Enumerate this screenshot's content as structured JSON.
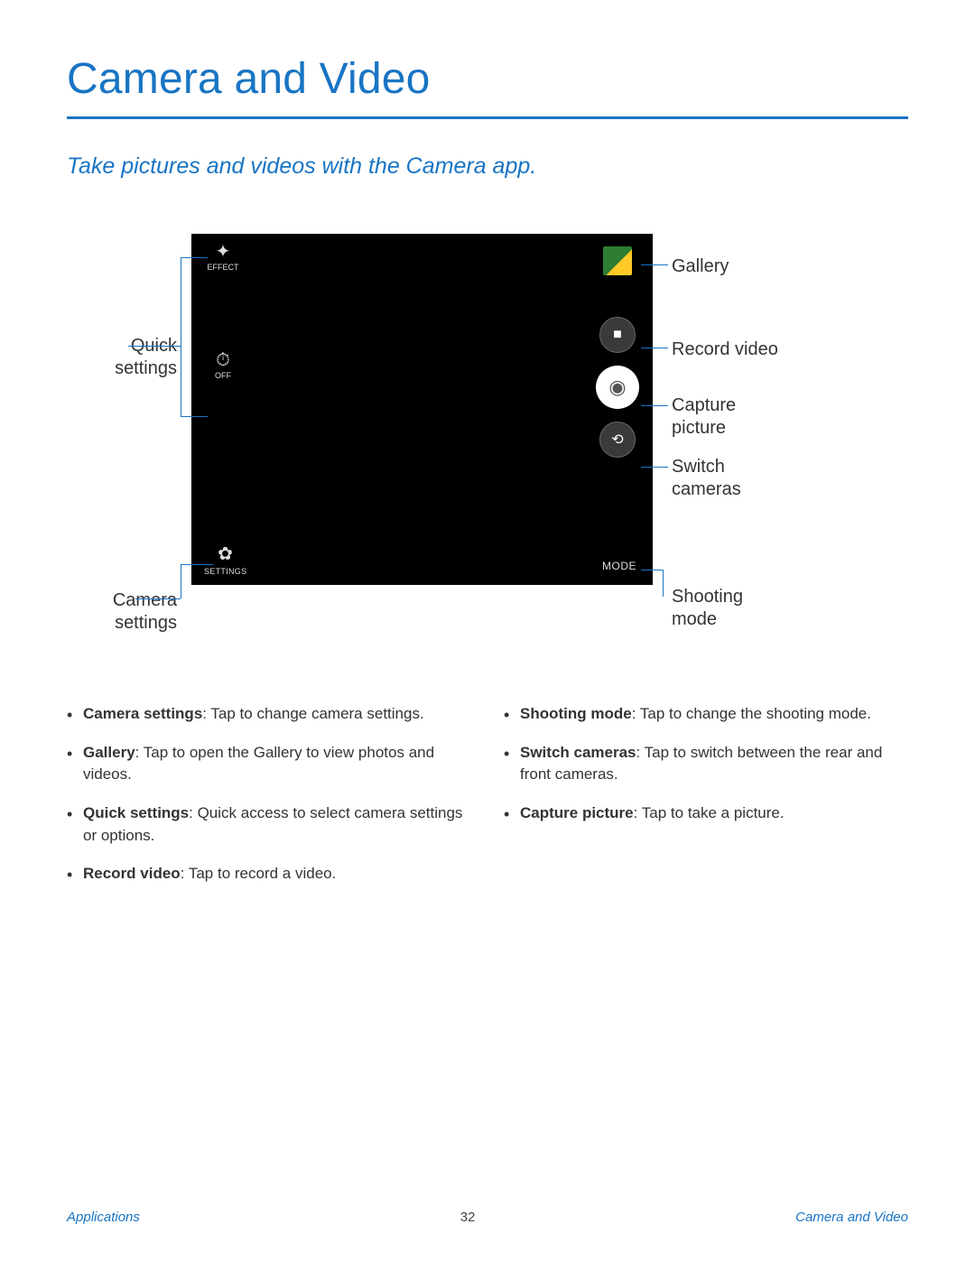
{
  "title": "Camera and Video",
  "subtitle": "Take pictures and videos with the Camera app.",
  "screen": {
    "effect_label": "EFFECT",
    "timer_label": "OFF",
    "settings_label": "SETTINGS",
    "mode_label": "MODE"
  },
  "callouts": {
    "quick_settings": "Quick\nsettings",
    "camera_settings": "Camera\nsettings",
    "gallery": "Gallery",
    "record_video": "Record video",
    "capture_picture": "Capture\npicture",
    "switch_cameras": "Switch\ncameras",
    "shooting_mode": "Shooting\nmode"
  },
  "bullets_left": [
    {
      "term": "Camera settings",
      "desc": ": Tap to change camera settings."
    },
    {
      "term": "Gallery",
      "desc": ": Tap to open the Gallery to view photos and videos."
    },
    {
      "term": "Quick settings",
      "desc": ": Quick access to select camera settings or options."
    },
    {
      "term": "Record video",
      "desc": ": Tap to record a video."
    }
  ],
  "bullets_right": [
    {
      "term": "Shooting mode",
      "desc": ": Tap to change the shooting mode."
    },
    {
      "term": "Switch cameras",
      "desc": ": Tap to switch between the rear and front cameras."
    },
    {
      "term": "Capture picture",
      "desc": ": Tap to take a picture."
    }
  ],
  "footer": {
    "left": "Applications",
    "page": "32",
    "right": "Camera and Video"
  }
}
